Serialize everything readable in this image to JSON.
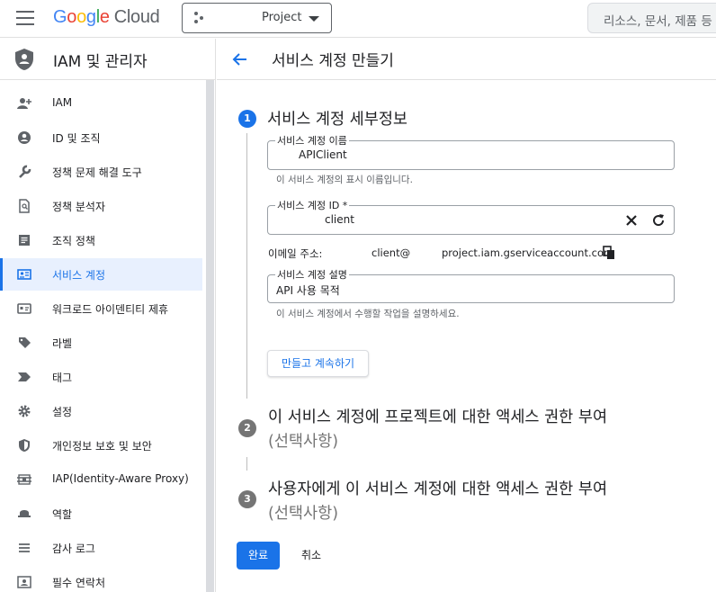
{
  "header": {
    "logo_google": [
      "G",
      "o",
      "o",
      "g",
      "l",
      "e"
    ],
    "logo_cloud": "Cloud",
    "project_label": "Project",
    "search_placeholder": "리소스, 문서, 제품 등"
  },
  "sidebar": {
    "title": "IAM 및 관리자",
    "items": [
      {
        "label": "IAM",
        "icon": "person-add-icon"
      },
      {
        "label": "ID 및 조직",
        "icon": "account-circle-icon"
      },
      {
        "label": "정책 문제 해결 도구",
        "icon": "wrench-icon"
      },
      {
        "label": "정책 분석자",
        "icon": "document-search-icon"
      },
      {
        "label": "조직 정책",
        "icon": "list-document-icon"
      },
      {
        "label": "서비스 계정",
        "icon": "service-account-icon",
        "active": true
      },
      {
        "label": "워크로드 아이덴티티 제휴",
        "icon": "id-card-icon"
      },
      {
        "label": "라벨",
        "icon": "label-icon"
      },
      {
        "label": "태그",
        "icon": "tag-icon"
      },
      {
        "label": "설정",
        "icon": "gear-icon"
      },
      {
        "label": "개인정보 보호 및 보안",
        "icon": "shield-icon"
      },
      {
        "label": "IAP(Identity-Aware Proxy)",
        "icon": "proxy-icon"
      },
      {
        "label": "역할",
        "icon": "hat-icon"
      },
      {
        "label": "감사 로그",
        "icon": "list-icon"
      },
      {
        "label": "필수 연락처",
        "icon": "contact-icon"
      }
    ]
  },
  "main": {
    "title": "서비스 계정 만들기",
    "step1": {
      "number": "1",
      "title": "서비스 계정 세부정보",
      "name_label": "서비스 계정 이름",
      "name_value": "APIClient",
      "name_hint": "이 서비스 계정의 표시 이름입니다.",
      "id_label": "서비스 계정 ID *",
      "id_value": "client",
      "email_label": "이메일 주소:",
      "email_part1": "client@",
      "email_part2": "project.iam.gserviceaccount.com",
      "desc_label": "서비스 계정 설명",
      "desc_value": "API 사용 목적",
      "desc_hint": "이 서비스 계정에서 수행할 작업을 설명하세요.",
      "continue_label": "만들고 계속하기"
    },
    "step2": {
      "number": "2",
      "title": "이 서비스 계정에 프로젝트에 대한 액세스 권한 부여",
      "optional": "(선택사항)"
    },
    "step3": {
      "number": "3",
      "title": "사용자에게 이 서비스 계정에 대한 액세스 권한 부여",
      "optional": "(선택사항)"
    },
    "done_label": "완료",
    "cancel_label": "취소"
  },
  "colors": {
    "accent": "#1a73e8",
    "active_bg": "#e8f0fe",
    "inactive_step": "#757575"
  }
}
